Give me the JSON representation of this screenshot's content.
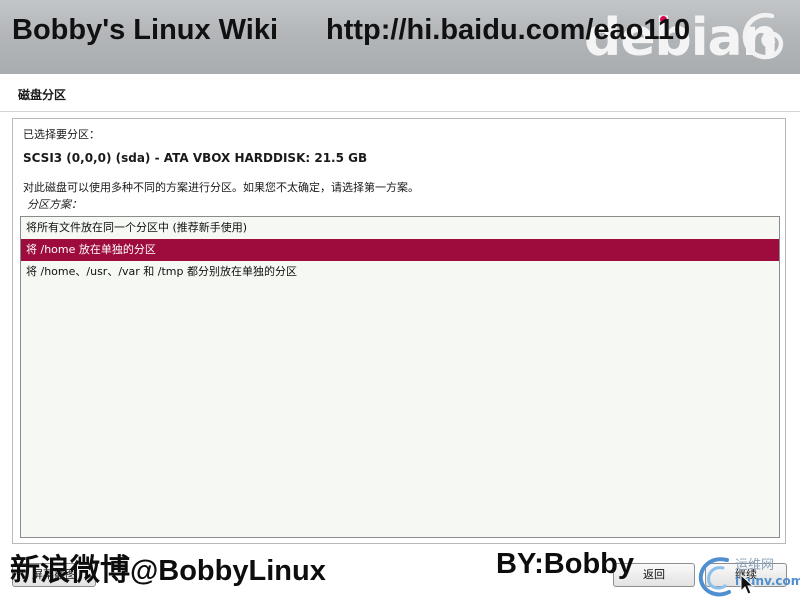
{
  "banner": {
    "watermark_left": "Bobby's Linux Wiki",
    "watermark_right": "http://hi.baidu.com/eao110",
    "logo_text": "debian",
    "icons": [
      "debian-swirl-icon"
    ]
  },
  "page": {
    "title": "磁盘分区"
  },
  "content": {
    "selected_label": "已选择要分区：",
    "disk_info": "SCSI3 (0,0,0) (sda) - ATA VBOX HARDDISK: 21.5 GB",
    "help_text": "对此磁盘可以使用多种不同的方案进行分区。如果您不太确定，请选择第一方案。",
    "list_label": "分区方案：",
    "options": [
      {
        "label": "将所有文件放在同一个分区中 (推荐新手使用)",
        "selected": false
      },
      {
        "label": "将 /home 放在单独的分区",
        "selected": true
      },
      {
        "label": "将 /home、/usr、/var 和 /tmp 都分别放在单独的分区",
        "selected": false
      }
    ]
  },
  "buttons": {
    "screenshot": "屏幕截图",
    "back": "返回",
    "continue": "继续"
  },
  "overlay": {
    "weibo_cn": "新浪微博",
    "weibo_handle": "@BobbyLinux",
    "by": "BY:Bobby",
    "site_cn": "运维网",
    "site_en": "iyunv.com"
  },
  "colors": {
    "selection": "#9e0b3d",
    "debian_red": "#d70751",
    "listbox_bg": "#f5f8f3"
  }
}
